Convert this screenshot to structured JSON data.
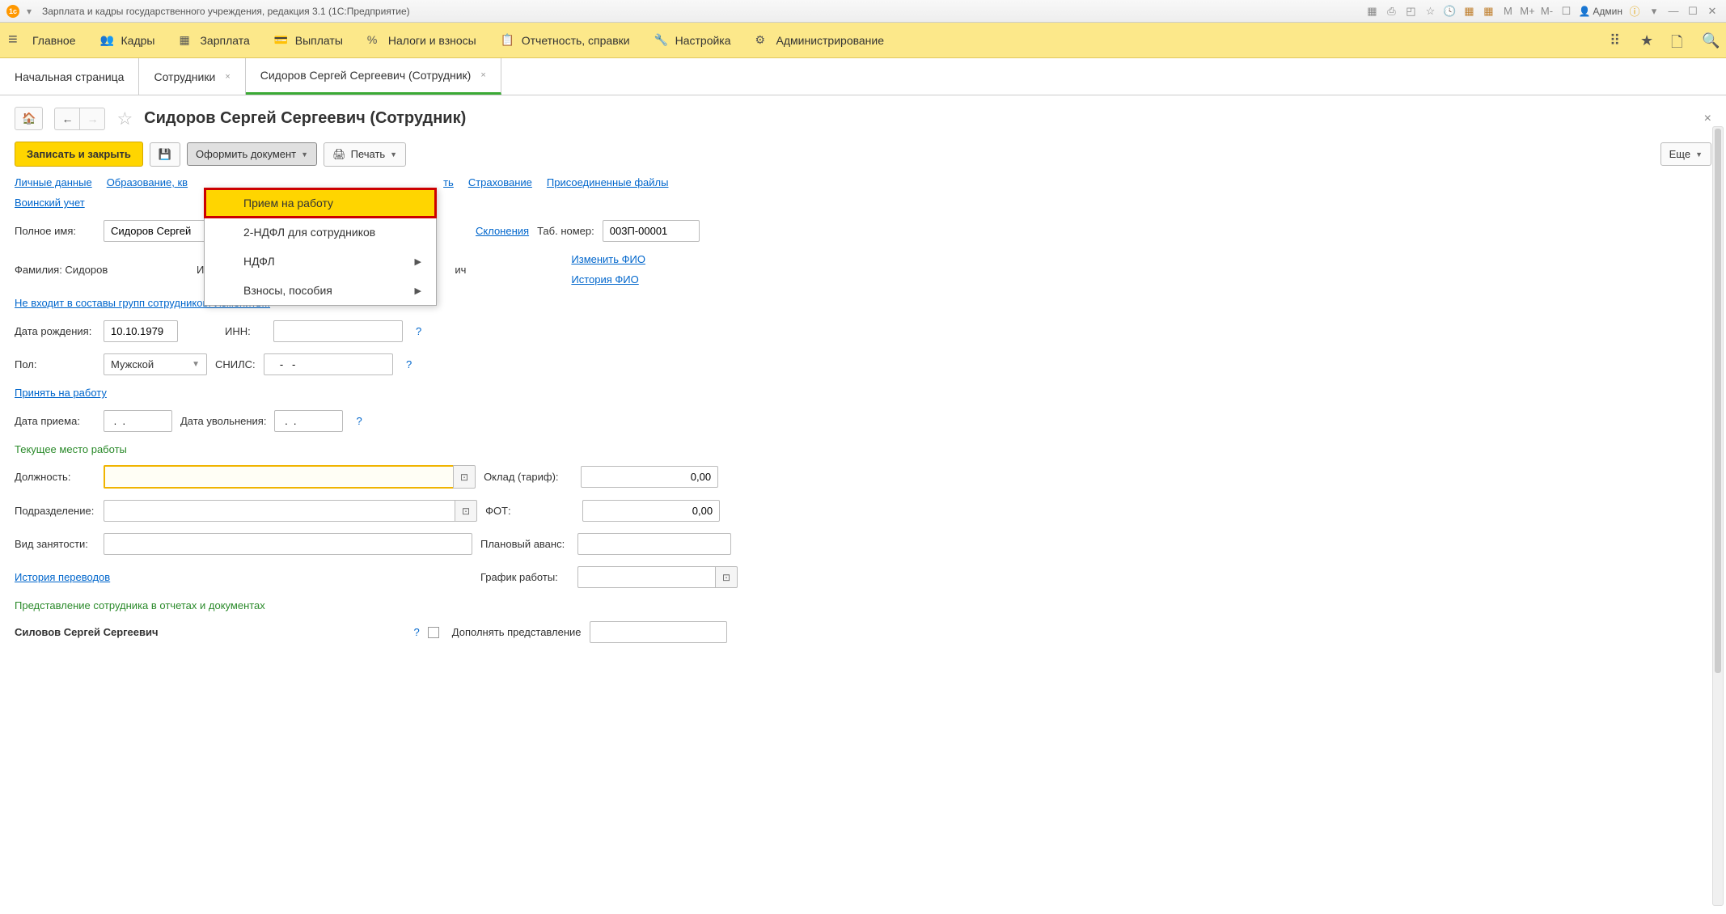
{
  "titlebar": {
    "title": "Зарплата и кадры государственного учреждения, редакция 3.1  (1С:Предприятие)",
    "user_label": "Админ"
  },
  "menubar": {
    "items": [
      {
        "label": "Главное"
      },
      {
        "label": "Кадры"
      },
      {
        "label": "Зарплата"
      },
      {
        "label": "Выплаты"
      },
      {
        "label": "Налоги и взносы"
      },
      {
        "label": "Отчетность, справки"
      },
      {
        "label": "Настройка"
      },
      {
        "label": "Администрирование"
      }
    ]
  },
  "tabs": [
    {
      "label": "Начальная страница",
      "closable": false,
      "active": false
    },
    {
      "label": "Сотрудники",
      "closable": true,
      "active": false
    },
    {
      "label": "Сидоров Сергей Сергеевич (Сотрудник)",
      "closable": true,
      "active": true
    }
  ],
  "page": {
    "title": "Сидоров Сергей Сергеевич (Сотрудник)"
  },
  "toolbar": {
    "save_close": "Записать и закрыть",
    "create_doc": "Оформить документ",
    "print": "Печать",
    "more": "Еще"
  },
  "dropdown": {
    "items": [
      {
        "label": "Прием на работу",
        "highlighted": true,
        "submenu": false
      },
      {
        "label": "2-НДФЛ для сотрудников",
        "highlighted": false,
        "submenu": false
      },
      {
        "label": "НДФЛ",
        "highlighted": false,
        "submenu": true
      },
      {
        "label": "Взносы, пособия",
        "highlighted": false,
        "submenu": true
      }
    ]
  },
  "nav_links": {
    "row1": [
      "Личные данные",
      "Образование, кв",
      "ть",
      "Страхование",
      "Присоединенные файлы"
    ],
    "row2": "Воинский учет"
  },
  "form": {
    "full_name_label": "Полное имя:",
    "full_name_value": "Сидоров Сергей",
    "declensions_link": "Склонения",
    "tab_number_label": "Таб. номер:",
    "tab_number_value": "003П-00001",
    "surname_label": "Фамилия: Сидоров",
    "name_label_partial": "И",
    "patronymic_partial": "ич",
    "change_fio_link": "Изменить ФИО",
    "history_fio_link": "История ФИО",
    "groups_link": "Не входит в составы групп сотрудников. Изменить...",
    "birth_date_label": "Дата рождения:",
    "birth_date_value": "10.10.1979",
    "inn_label": "ИНН:",
    "inn_value": "",
    "gender_label": "Пол:",
    "gender_value": "Мужской",
    "snils_label": "СНИЛС:",
    "snils_value": "   -   -",
    "hire_link": "Принять на работу",
    "hire_date_label": "Дата приема:",
    "hire_date_value": " .  .",
    "dismiss_date_label": "Дата увольнения:",
    "dismiss_date_value": " .  .",
    "current_job_header": "Текущее место работы",
    "position_label": "Должность:",
    "position_value": "",
    "salary_label": "Оклад (тариф):",
    "salary_value": "0,00",
    "department_label": "Подразделение:",
    "department_value": "",
    "fot_label": "ФОТ:",
    "fot_value": "0,00",
    "employment_type_label": "Вид занятости:",
    "employment_type_value": "",
    "advance_label": "Плановый аванс:",
    "advance_value": "",
    "transfers_link": "История переводов",
    "schedule_label": "График работы:",
    "schedule_value": "",
    "representation_header": "Представление сотрудника в отчетах и документах",
    "representation_value": "Силовов Сергей Сергеевич",
    "supplement_label": "Дополнять представление"
  }
}
